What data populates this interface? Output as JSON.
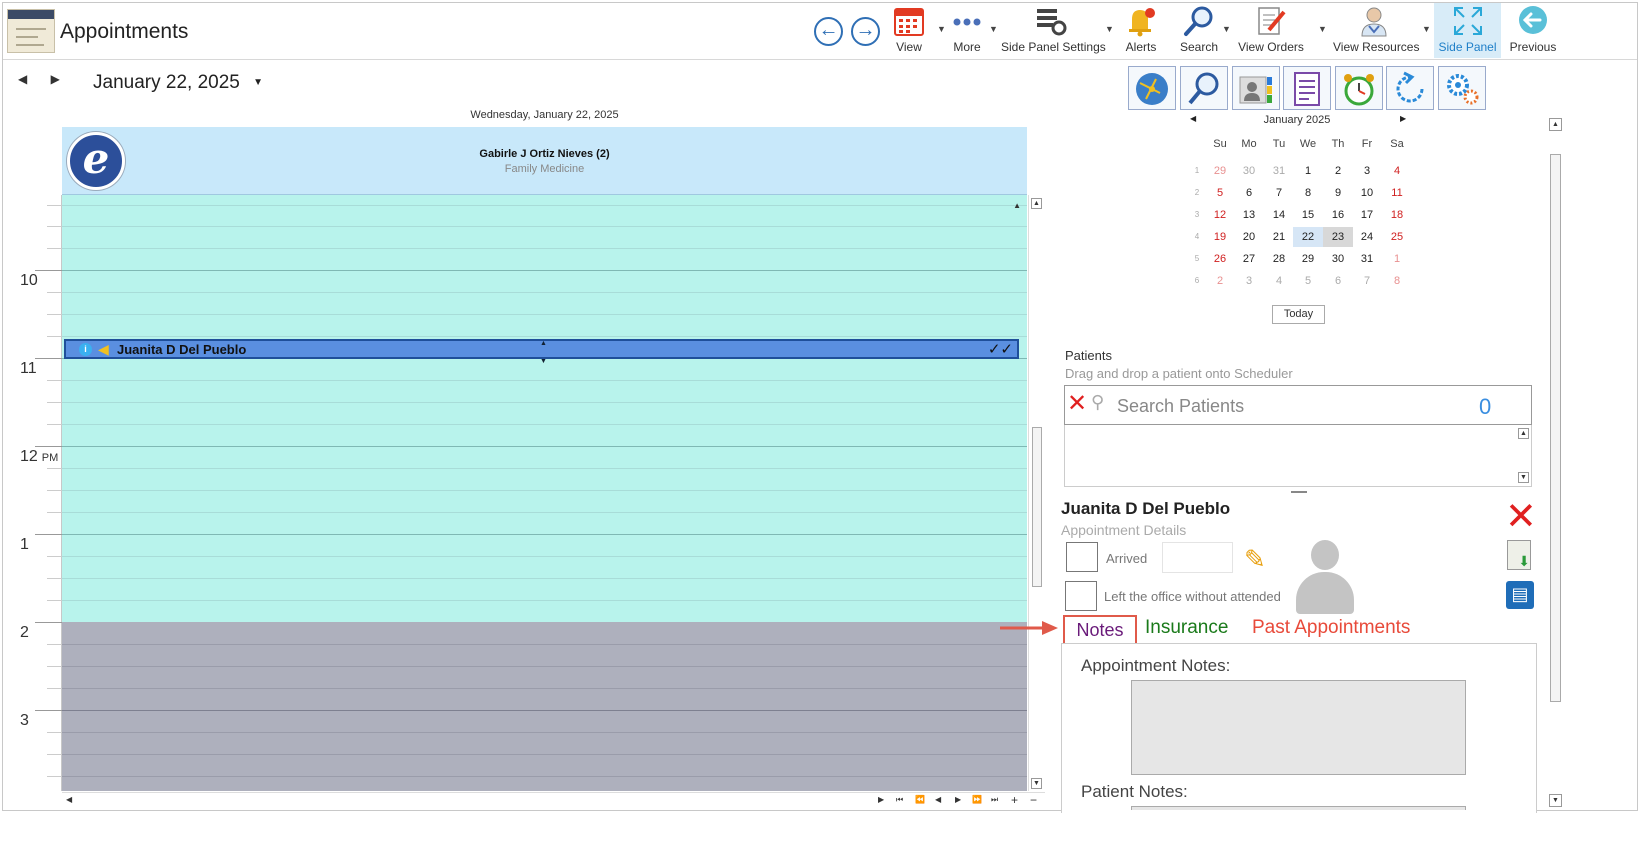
{
  "app": {
    "title": "Appointments"
  },
  "toolbar": {
    "back_icon": "arrow-left-circle-icon",
    "forward_icon": "arrow-right-circle-icon",
    "buttons": [
      {
        "label": "View",
        "icon": "calendar-grid-icon"
      },
      {
        "label": "More",
        "icon": "more-dots-icon"
      },
      {
        "label": "Side Panel Settings",
        "icon": "panel-settings-icon"
      },
      {
        "label": "Alerts",
        "icon": "bell-icon"
      },
      {
        "label": "Search",
        "icon": "magnifier-icon"
      },
      {
        "label": "View Orders",
        "icon": "orders-icon"
      },
      {
        "label": "View Resources",
        "icon": "doctor-icon"
      },
      {
        "label": "Side Panel",
        "icon": "expand-icon"
      },
      {
        "label": "Previous",
        "icon": "previous-icon"
      }
    ],
    "accent": "#2f6fb5"
  },
  "scheduler": {
    "date_title": "January 22, 2025",
    "day_header": "Wednesday, January 22, 2025",
    "resource_name": "Gabirle J Ortiz Nieves (2)",
    "resource_specialty": "Family Medicine",
    "hours": [
      "10",
      "11",
      "12",
      "1",
      "2",
      "3"
    ],
    "pm_label": "PM",
    "appointment": {
      "patient": "Juanita D Del Pueblo",
      "status_marks": "✓✓"
    },
    "colors": {
      "work": "#b8f3ec",
      "offhours": "#aeb0bd",
      "appointment": "#5a8fe0"
    }
  },
  "side_panel": {
    "icons": [
      "globe-network-icon",
      "search-icon",
      "contact-card-icon",
      "checklist-icon",
      "alarm-clock-icon",
      "refresh-icon",
      "gears-icon"
    ],
    "minical": {
      "month": "January 2025",
      "dow": [
        "Su",
        "Mo",
        "Tu",
        "We",
        "Th",
        "Fr",
        "Sa"
      ],
      "weeks": [
        "1",
        "2",
        "3",
        "4",
        "5",
        "6"
      ],
      "days": [
        [
          "29",
          "30",
          "31",
          "1",
          "2",
          "3",
          "4"
        ],
        [
          "5",
          "6",
          "7",
          "8",
          "9",
          "10",
          "11"
        ],
        [
          "12",
          "13",
          "14",
          "15",
          "16",
          "17",
          "18"
        ],
        [
          "19",
          "20",
          "21",
          "22",
          "23",
          "24",
          "25"
        ],
        [
          "26",
          "27",
          "28",
          "29",
          "30",
          "31",
          "1"
        ],
        [
          "2",
          "3",
          "4",
          "5",
          "6",
          "7",
          "8"
        ]
      ],
      "today_label": "Today"
    },
    "patients": {
      "label": "Patients",
      "hint": "Drag and drop a patient onto Scheduler",
      "search_placeholder": "Search Patients",
      "count": "0"
    },
    "details": {
      "patient_name": "Juanita D Del Pueblo",
      "section": "Appointment Details",
      "arrived_label": "Arrived",
      "left_label": "Left the office without attended",
      "tabs": {
        "notes": "Notes",
        "insurance": "Insurance",
        "past": "Past Appointments"
      },
      "appointment_notes_label": "Appointment Notes:",
      "patient_notes_label": "Patient Notes:"
    }
  }
}
